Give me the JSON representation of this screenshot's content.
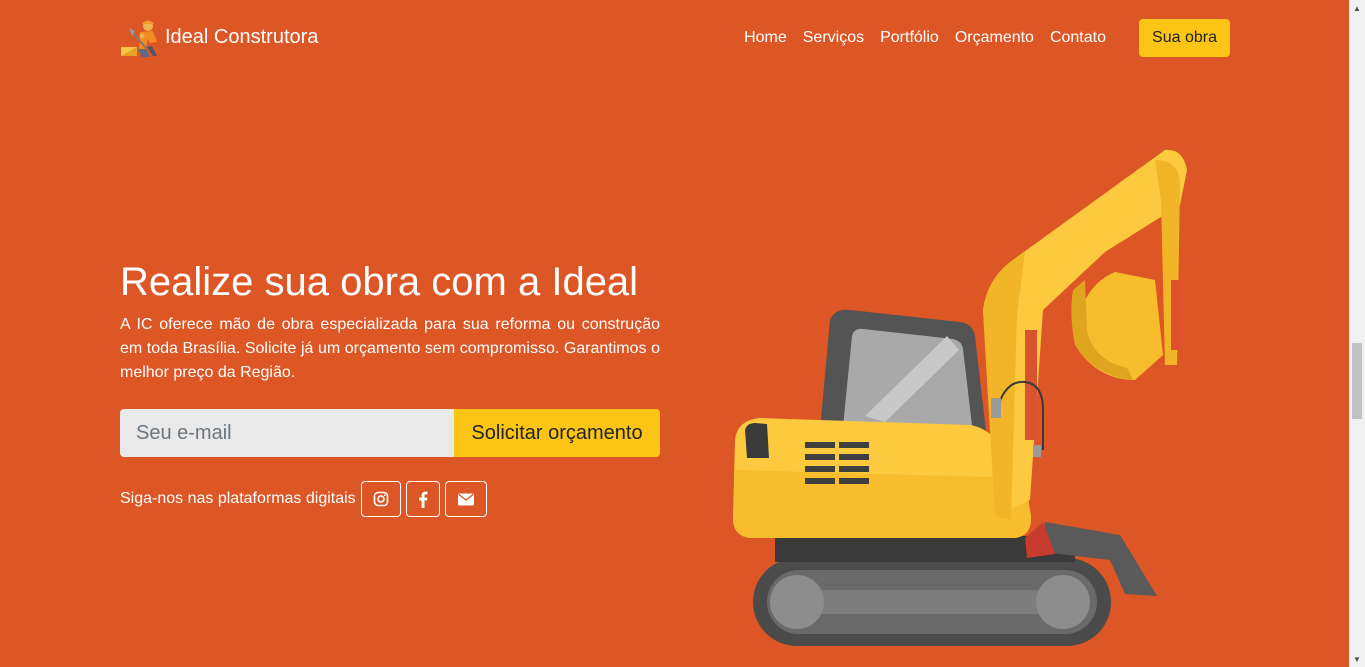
{
  "brand": {
    "name": "Ideal Construtora",
    "logo_icon": "construction-worker-icon"
  },
  "nav": {
    "items": [
      "Home",
      "Serviços",
      "Portfólio",
      "Orçamento",
      "Contato"
    ]
  },
  "header_cta": {
    "label": "Sua obra"
  },
  "hero": {
    "title": "Realize sua obra com a Ideal",
    "description": "A IC oferece mão de obra especializada para sua reforma ou construção em toda Brasília. Solicite já um orçamento sem compromisso. Garantimos o melhor preço da Região.",
    "email_placeholder": "Seu e-mail",
    "email_value": "",
    "submit_label": "Solicitar orçamento"
  },
  "social": {
    "label": "Siga-nos nas plataformas digitais",
    "icons": [
      "instagram-icon",
      "facebook-icon",
      "envelope-icon"
    ]
  },
  "illustration": {
    "icon": "excavator-illustration"
  },
  "colors": {
    "background": "#dd5625",
    "accent": "#fcc414",
    "text": "#ffffff",
    "input_bg": "#e9e9e9"
  }
}
